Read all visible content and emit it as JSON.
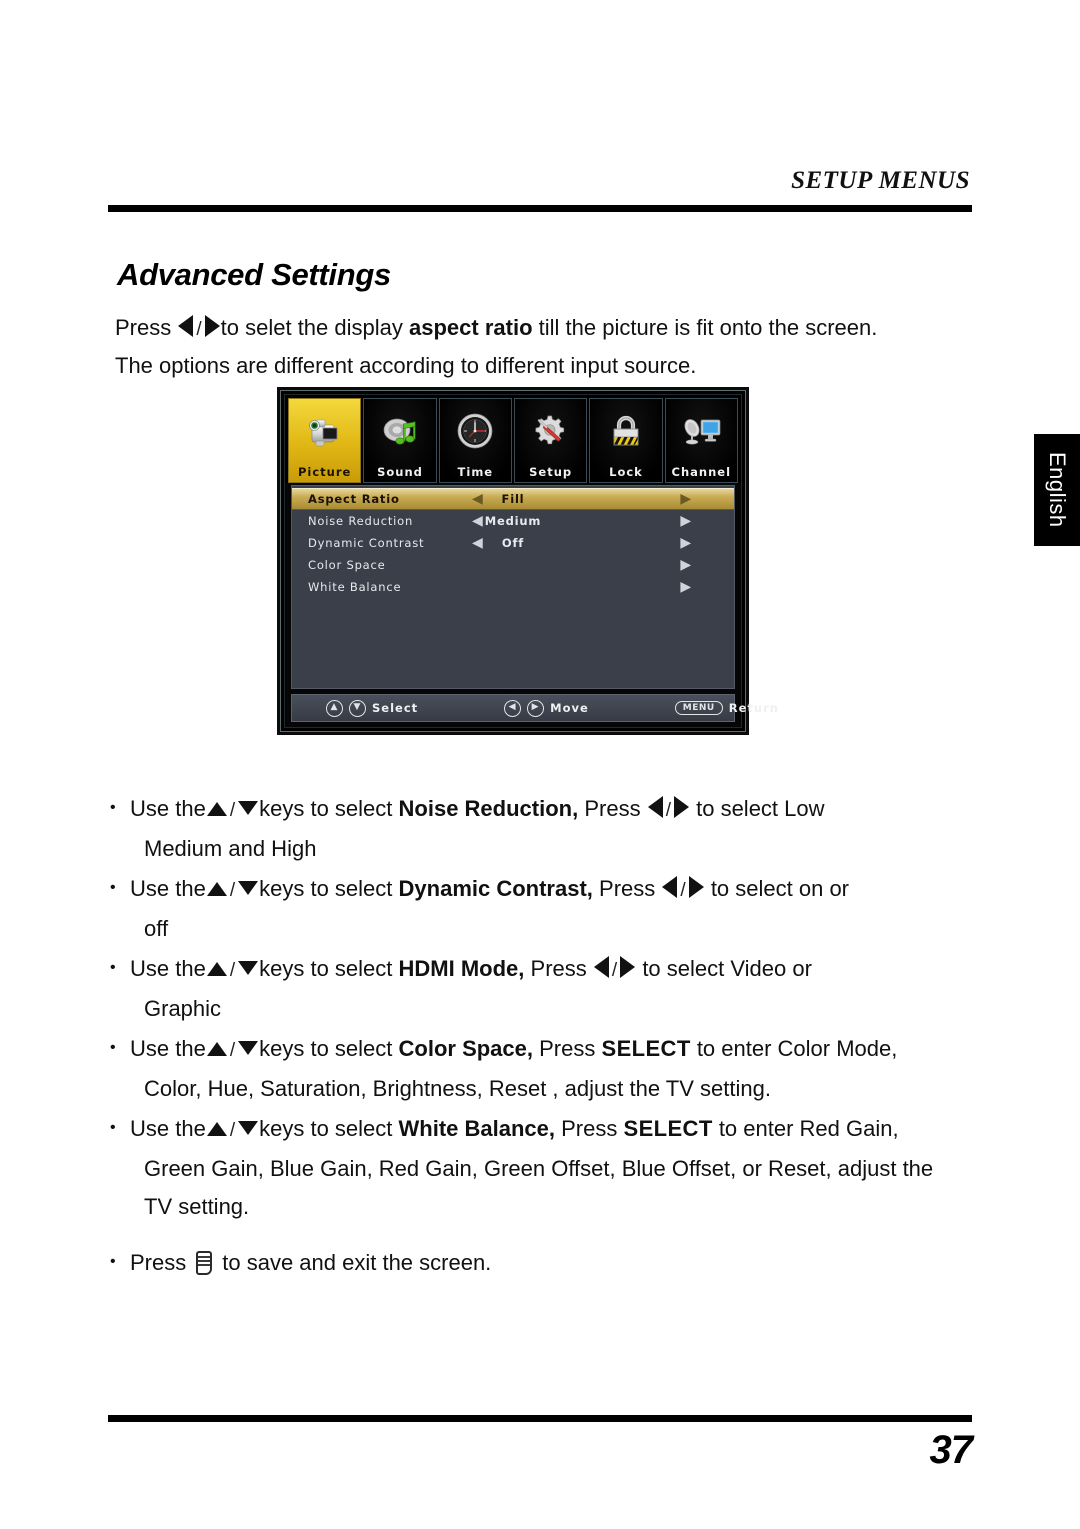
{
  "header": {
    "title": "SETUP MENUS"
  },
  "section": {
    "title": "Advanced Settings"
  },
  "intro": {
    "press_label": "Press",
    "left_icon": "triangle-left-icon",
    "separator": "/",
    "right_icon": "triangle-right-icon",
    "line1_a": "to selet the display",
    "line1_bold": "aspect ratio",
    "line1_b": "till the picture is fit onto the screen.",
    "line2": "The options are different according to different input source."
  },
  "osd": {
    "tabs": [
      {
        "label": "Picture",
        "icon": "camcorder-icon",
        "selected": true
      },
      {
        "label": "Sound",
        "icon": "speaker-music-note-icon",
        "selected": false
      },
      {
        "label": "Time",
        "icon": "clock-icon",
        "selected": false
      },
      {
        "label": "Setup",
        "icon": "gear-screwdriver-icon",
        "selected": false
      },
      {
        "label": "Lock",
        "icon": "padlock-icon",
        "selected": false
      },
      {
        "label": "Channel",
        "icon": "satellite-monitor-icon",
        "selected": false
      }
    ],
    "rows": [
      {
        "label": "Aspect Ratio",
        "value": "Fill",
        "left_arrow": "◀",
        "right_arrow": "▶",
        "selected": true
      },
      {
        "label": "Noise Reduction",
        "value": "Medium",
        "left_arrow": "◀",
        "right_arrow": "▶",
        "selected": false
      },
      {
        "label": "Dynamic Contrast",
        "value": "Off",
        "left_arrow": "◀",
        "right_arrow": "▶",
        "selected": false
      },
      {
        "label": "Color Space",
        "value": "",
        "left_arrow": "",
        "right_arrow": "▶",
        "selected": false
      },
      {
        "label": "White Balance",
        "value": "",
        "left_arrow": "",
        "right_arrow": "▶",
        "selected": false
      }
    ],
    "footer": {
      "select_up": "▲",
      "select_down": "▼",
      "select_label": "Select",
      "move_left": "◀",
      "move_right": "▶",
      "move_label": "Move",
      "menu_key": "MENU",
      "return_label": "Return"
    }
  },
  "language_tab": {
    "label": "English"
  },
  "bullets": [
    {
      "pre": "Use the",
      "up_icon": "triangle-up-icon",
      "slash": "/",
      "down_icon": "triangle-down-icon",
      "mid": "keys to select",
      "bold": "Noise Reduction,",
      "press": "Press",
      "has_lr": true,
      "post": "to select Low",
      "cont": "Medium and High"
    },
    {
      "pre": "Use the",
      "up_icon": "triangle-up-icon",
      "slash": "/",
      "down_icon": "triangle-down-icon",
      "mid": "keys to select",
      "bold": "Dynamic Contrast,",
      "press": "Press",
      "has_lr": true,
      "post": "to select  on or",
      "cont": "off"
    },
    {
      "pre": "Use the",
      "up_icon": "triangle-up-icon",
      "slash": "/",
      "down_icon": "triangle-down-icon",
      "mid": "keys to select",
      "bold": "HDMI Mode,",
      "press": "Press",
      "has_lr": true,
      "post": "to select  Video or",
      "cont": "Graphic"
    },
    {
      "pre": "Use the",
      "up_icon": "triangle-up-icon",
      "slash": "/",
      "down_icon": "triangle-down-icon",
      "mid": "keys to select",
      "bold": "Color Space,",
      "press": "Press",
      "has_lr": false,
      "select_key": "SELECT",
      "post": "to enter Color Mode,",
      "cont": "Color, Hue, Saturation, Brightness, Reset , adjust the TV setting."
    },
    {
      "pre": "Use the",
      "up_icon": "triangle-up-icon",
      "slash": "/",
      "down_icon": "triangle-down-icon",
      "mid": "keys to select",
      "bold": "White Balance,",
      "press": "Press",
      "has_lr": false,
      "select_key": "SELECT",
      "post": "to enter Red Gain,",
      "cont": "Green Gain, Blue Gain, Red Gain, Green Offset, Blue Offset, or Reset, adjust the",
      "cont2": "TV setting."
    }
  ],
  "last_bullet": {
    "press": "Press",
    "icon": "menu-button-icon",
    "text": "to save and exit the screen."
  },
  "footer": {
    "page_number": "37"
  }
}
